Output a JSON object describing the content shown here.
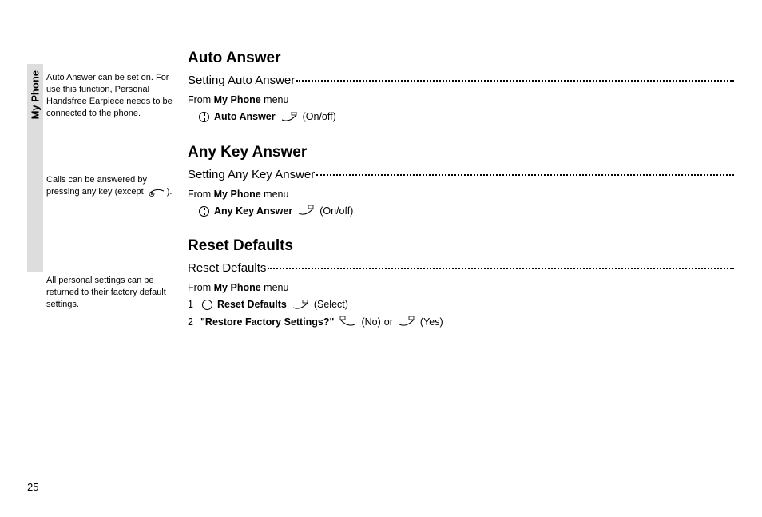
{
  "side_tab": {
    "label": "My Phone"
  },
  "notes": {
    "auto_answer": "Auto Answer can be set on. For use this function, Personal Handsfree Earpiece needs to be connected to the phone.",
    "any_key": "Calls can be answered by pressing any key (except",
    "any_key_tail": ").",
    "reset": "All personal settings can be returned to their factory default settings."
  },
  "sections": {
    "auto_answer": {
      "heading": "Auto Answer",
      "toc": "Setting Auto Answer",
      "from_prefix": "From ",
      "from_bold": "My Phone",
      "from_suffix": " menu",
      "item_bold": "Auto Answer",
      "action": "(On/off)"
    },
    "any_key": {
      "heading": "Any Key Answer",
      "toc": "Setting Any Key Answer",
      "from_prefix": "From ",
      "from_bold": "My Phone",
      "from_suffix": " menu",
      "item_bold": "Any Key Answer",
      "action": "(On/off)"
    },
    "reset": {
      "heading": "Reset Defaults",
      "toc": "Reset Defaults",
      "from_prefix": "From ",
      "from_bold": "My Phone",
      "from_suffix": " menu",
      "step1_num": "1",
      "step1_bold": "Reset Defaults",
      "step1_action": "(Select)",
      "step2_num": "2",
      "step2_bold": "\"Restore Factory Settings?\"",
      "step2_no": "(No)",
      "step2_or": " or ",
      "step2_yes": "(Yes)"
    }
  },
  "page_number": "25"
}
